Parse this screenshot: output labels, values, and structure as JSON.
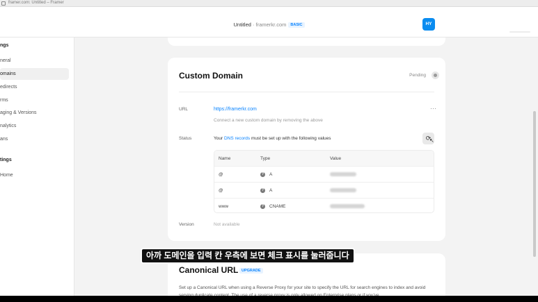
{
  "browser": {
    "url": "framer.com: Untitled – Framer"
  },
  "header": {
    "project": "Untitled",
    "separator": " · ",
    "domain": "framerkr.com",
    "plan": "BASIC",
    "avatar": "HY"
  },
  "sidebar": {
    "section1": "ngs",
    "items": [
      "neral",
      "omains",
      "edirects",
      "rms",
      "aging & Versions",
      "nalytics",
      "ans"
    ],
    "active_index": 1,
    "section2": "tings",
    "items2": [
      "Home"
    ]
  },
  "custom_domain": {
    "title": "Custom Domain",
    "status_label": "Pending",
    "url_label": "URL",
    "url_value": "https://framerkr.com",
    "url_hint": "Connect a new custom domain by removing the above",
    "more": "···",
    "status_field_label": "Status",
    "status_prefix": "Your ",
    "status_link": "DNS records",
    "status_suffix": " must be set up with the following values",
    "refresh": "⟳",
    "table": {
      "headers": [
        "Name",
        "Type",
        "Value"
      ],
      "rows": [
        {
          "name": "@",
          "icon": "?",
          "type": "A"
        },
        {
          "name": "@",
          "icon": "?",
          "type": "A"
        },
        {
          "name": "www",
          "icon": "?",
          "type": "CNAME"
        }
      ]
    },
    "version_label": "Version",
    "version_value": "Not available"
  },
  "canonical": {
    "title": "Canonical URL",
    "badge": "UPGRADE",
    "description": "Set up a Canonical URL when using a Reverse Proxy for your site to specify the URL for search engines to index and avoid serving duplicate content. The use of a reverse proxy is only allowed on Enterprise plans or if you've"
  },
  "caption": "아까 도메인을 입력 칸 우측에 보면 체크 표시를 눌러줍니다",
  "colors": {
    "accent": "#0a84ff",
    "avatar": "#0a8cf0"
  }
}
